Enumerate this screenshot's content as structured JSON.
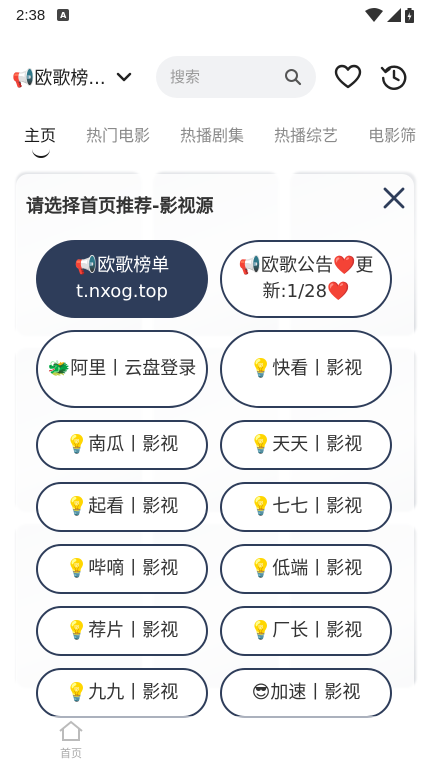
{
  "status_bar": {
    "time": "2:38",
    "badge": "A"
  },
  "header": {
    "source_label": "📢欧歌榜...",
    "search_placeholder": "搜索"
  },
  "tabs": [
    {
      "label": "主页",
      "active": true
    },
    {
      "label": "热门电影",
      "active": false
    },
    {
      "label": "热播剧集",
      "active": false
    },
    {
      "label": "热播综艺",
      "active": false
    },
    {
      "label": "电影筛",
      "active": false
    }
  ],
  "modal": {
    "title": "请选择首页推荐-影视源",
    "sources": [
      {
        "label": "📢欧歌榜单\nt.nxog.top",
        "selected": true
      },
      {
        "label": "📢欧歌公告❤️更新:1/28❤️",
        "selected": false
      },
      {
        "label": "🐲阿里丨云盘登录",
        "selected": false
      },
      {
        "label": "💡快看丨影视",
        "selected": false
      },
      {
        "label": "💡南瓜丨影视",
        "selected": false
      },
      {
        "label": "💡天天丨影视",
        "selected": false
      },
      {
        "label": "💡起看丨影视",
        "selected": false
      },
      {
        "label": "💡七七丨影视",
        "selected": false
      },
      {
        "label": "💡哔嘀丨影视",
        "selected": false
      },
      {
        "label": "💡低端丨影视",
        "selected": false
      },
      {
        "label": "💡荐片丨影视",
        "selected": false
      },
      {
        "label": "💡厂长丨影视",
        "selected": false
      },
      {
        "label": "💡九九丨影视",
        "selected": false
      },
      {
        "label": "😎加速丨影视",
        "selected": false
      }
    ]
  },
  "bottom_nav": {
    "home_label": "首页"
  },
  "colors": {
    "accent": "#2e3d5a",
    "tab_inactive": "#8a8a8a",
    "search_bg": "#f1f2f4"
  },
  "icons": [
    "chevron-down-icon",
    "search-icon",
    "heart-icon",
    "history-icon",
    "close-icon",
    "wifi-icon",
    "signal-icon",
    "battery-icon"
  ]
}
